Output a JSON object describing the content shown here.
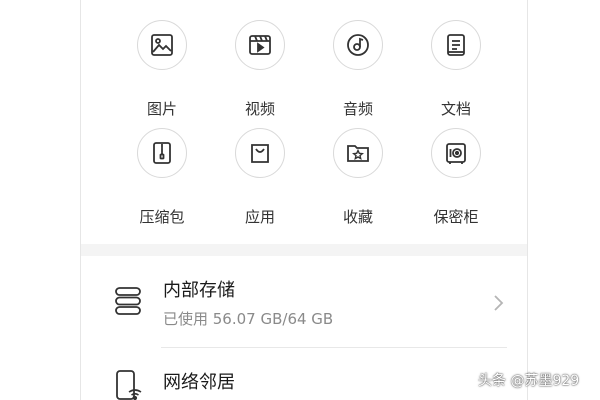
{
  "categories": [
    {
      "label": "图片",
      "icon": "image-icon"
    },
    {
      "label": "视频",
      "icon": "video-icon"
    },
    {
      "label": "音频",
      "icon": "music-icon"
    },
    {
      "label": "文档",
      "icon": "document-icon"
    },
    {
      "label": "压缩包",
      "icon": "zip-icon"
    },
    {
      "label": "应用",
      "icon": "app-bag-icon"
    },
    {
      "label": "收藏",
      "icon": "favorite-folder-icon"
    },
    {
      "label": "保密柜",
      "icon": "safe-icon"
    }
  ],
  "storage": {
    "title": "内部存储",
    "usage": "已使用 56.07 GB/64 GB",
    "icon": "storage-icon"
  },
  "network": {
    "title": "网络邻居",
    "icon": "network-device-icon"
  },
  "watermark": "头条 @苏墨929",
  "colors": {
    "icon_stroke": "#333333",
    "circle_border": "#d9d9d9",
    "band": "#f4f4f4",
    "subtext": "#8a8a8a"
  }
}
